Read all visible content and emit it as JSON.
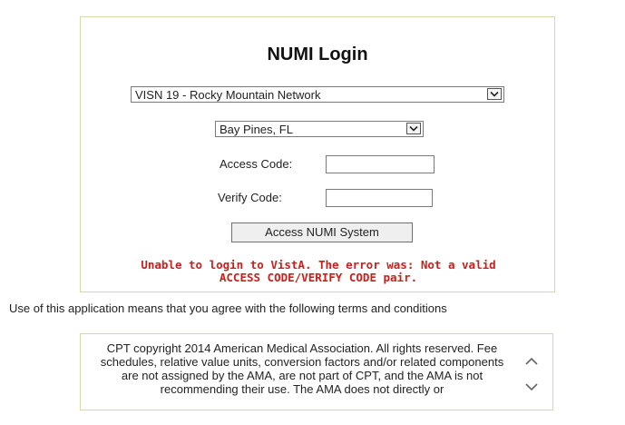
{
  "login": {
    "title": "NUMI Login",
    "network_select": {
      "value": "VISN 19 - Rocky Mountain Network"
    },
    "site_select": {
      "value": "Bay Pines, FL"
    },
    "access_code_label": "Access Code:",
    "access_code_value": "",
    "verify_code_label": "Verify Code:",
    "verify_code_value": "",
    "submit_label": "Access NUMI System",
    "error_line1": "Unable to login to VistA. The error was: Not a valid",
    "error_line2": "ACCESS CODE/VERIFY CODE pair."
  },
  "terms": {
    "notice": "Use of this application means that you agree with the following terms and conditions",
    "text": "CPT copyright 2014 American Medical Association. All rights reserved. Fee schedules, relative value units, conversion factors and/or related components are not assigned by the AMA, are not part of CPT, and the AMA is not recommending their use. The AMA does not directly or"
  },
  "icons": {
    "dropdown": "chevron-down-icon",
    "scroll_up": "chevron-up-icon",
    "scroll_down": "chevron-down-icon"
  },
  "colors": {
    "error": "#c8201d",
    "border": "#d9d6a8"
  }
}
